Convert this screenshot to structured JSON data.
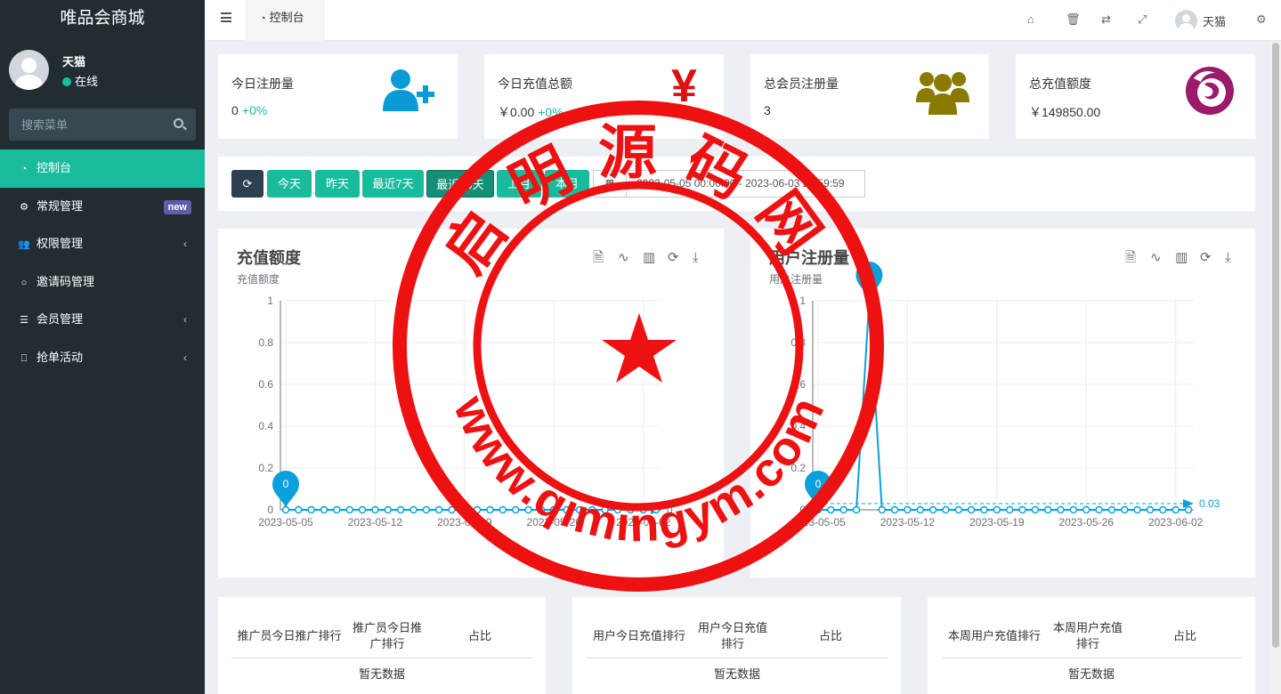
{
  "sidebar": {
    "brand": "唯品会商城",
    "user": {
      "name": "天猫",
      "status": "在线"
    },
    "search_placeholder": "搜索菜单",
    "items": [
      {
        "label": "控制台",
        "icon": "dashboard-icon",
        "active": true
      },
      {
        "label": "常规管理",
        "icon": "cogs-icon",
        "badge": "new"
      },
      {
        "label": "权限管理",
        "icon": "group-icon",
        "has_children": true
      },
      {
        "label": "邀请码管理",
        "icon": "circle-icon"
      },
      {
        "label": "会员管理",
        "icon": "list-icon",
        "has_children": true
      },
      {
        "label": "抢单活动",
        "icon": "bookmark-icon",
        "has_children": true
      }
    ]
  },
  "header": {
    "tab_label": "控制台",
    "user_name": "天猫",
    "icons": [
      "home-icon",
      "trash-icon",
      "language-icon",
      "fullscreen-icon",
      "settings-icon"
    ]
  },
  "stats": [
    {
      "label": "今日注册量",
      "value": "0",
      "pct": "+0%",
      "icon": "user-plus-icon",
      "color": "#0a9bd6"
    },
    {
      "label": "今日充值总额",
      "value": "￥0.00",
      "pct": "+0%",
      "icon": "yen-icon",
      "color": "#dd1111"
    },
    {
      "label": "总会员注册量",
      "value": "3",
      "icon": "users-icon",
      "color": "#8a7a00"
    },
    {
      "label": "总充值额度",
      "value": "￥149850.00",
      "icon": "firefox-icon",
      "color": "#9b1a6a"
    }
  ],
  "toolbar": {
    "buttons": [
      "今天",
      "昨天",
      "最近7天",
      "最近30天",
      "上月",
      "本月"
    ],
    "date_range": "2023-05-05 00:00:00 - 2023-06-03 23:59:59"
  },
  "charts": {
    "recharge": {
      "title": "充值额度",
      "subtitle": "充值额度"
    },
    "register": {
      "title": "用户注册量",
      "subtitle": "用户注册量"
    }
  },
  "chart_data": [
    {
      "type": "line",
      "title": "充值额度",
      "subtitle": "充值额度",
      "x": [
        "2023-05-05",
        "2023-05-06",
        "2023-05-07",
        "2023-05-08",
        "2023-05-09",
        "2023-05-10",
        "2023-05-11",
        "2023-05-12",
        "2023-05-13",
        "2023-05-14",
        "2023-05-15",
        "2023-05-16",
        "2023-05-17",
        "2023-05-18",
        "2023-05-19",
        "2023-05-20",
        "2023-05-21",
        "2023-05-22",
        "2023-05-23",
        "2023-05-24",
        "2023-05-25",
        "2023-05-26",
        "2023-05-27",
        "2023-05-28",
        "2023-05-29",
        "2023-05-30",
        "2023-05-31",
        "2023-06-01",
        "2023-06-02",
        "2023-06-03"
      ],
      "series": [
        {
          "values": [
            0,
            0,
            0,
            0,
            0,
            0,
            0,
            0,
            0,
            0,
            0,
            0,
            0,
            0,
            0,
            0,
            0,
            0,
            0,
            0,
            0,
            0,
            0,
            0,
            0,
            0,
            0,
            0,
            0,
            0
          ]
        }
      ],
      "xticks": [
        "2023-05-05",
        "2023-05-12",
        "2023-05-19",
        "2023-05-26",
        "2023-06-02"
      ],
      "yticks": [
        0,
        0.2,
        0.4,
        0.6,
        0.8,
        1
      ],
      "ylim": [
        0,
        1
      ],
      "max_marker": "0",
      "avg_label": "0",
      "grid": true
    },
    {
      "type": "line",
      "title": "用户注册量",
      "subtitle": "用户注册量",
      "x": [
        "2023-05-05",
        "2023-05-06",
        "2023-05-07",
        "2023-05-08",
        "2023-05-09",
        "2023-05-10",
        "2023-05-11",
        "2023-05-12",
        "2023-05-13",
        "2023-05-14",
        "2023-05-15",
        "2023-05-16",
        "2023-05-17",
        "2023-05-18",
        "2023-05-19",
        "2023-05-20",
        "2023-05-21",
        "2023-05-22",
        "2023-05-23",
        "2023-05-24",
        "2023-05-25",
        "2023-05-26",
        "2023-05-27",
        "2023-05-28",
        "2023-05-29",
        "2023-05-30",
        "2023-05-31",
        "2023-06-01",
        "2023-06-02",
        "2023-06-03"
      ],
      "series": [
        {
          "values": [
            0,
            0,
            0,
            0,
            1,
            0,
            0,
            0,
            0,
            0,
            0,
            0,
            0,
            0,
            0,
            0,
            0,
            0,
            0,
            0,
            0,
            0,
            0,
            0,
            0,
            0,
            0,
            0,
            0,
            0
          ]
        }
      ],
      "xticks": [
        "2023-05-05",
        "2023-05-12",
        "2023-05-19",
        "2023-05-26",
        "2023-06-02"
      ],
      "yticks": [
        0,
        0.2,
        0.4,
        0.6,
        0.8,
        1
      ],
      "ylim": [
        0,
        1
      ],
      "max_marker": "1",
      "min_marker": "0",
      "avg_label": "0.03",
      "grid": true
    }
  ],
  "tables": [
    {
      "headers": [
        "推广员今日推广排行",
        "推广员今日推广排行",
        "占比"
      ],
      "empty": "暂无数据"
    },
    {
      "headers": [
        "用户今日充值排行",
        "用户今日充值排行",
        "占比"
      ],
      "empty": "暂无数据"
    },
    {
      "headers": [
        "本周用户充值排行",
        "本周用户充值排行",
        "占比"
      ],
      "empty": "暂无数据"
    }
  ],
  "watermark": {
    "text_top": "启明源码网",
    "text_bottom": "www.qimingym.com",
    "color": "#ee1111"
  }
}
